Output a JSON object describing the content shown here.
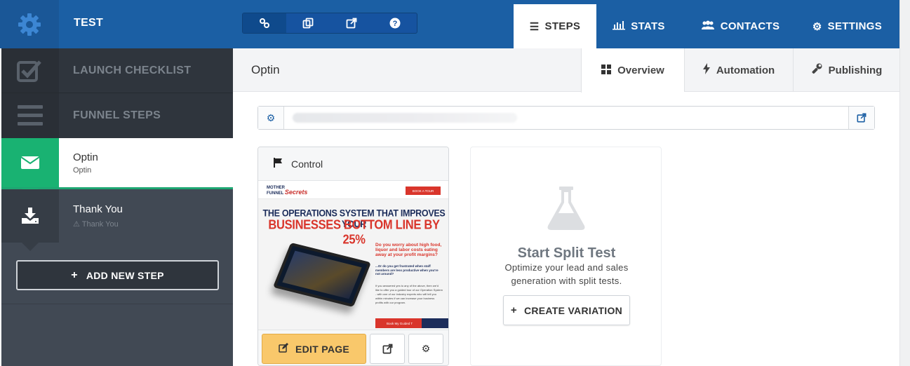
{
  "app": {
    "title": "TEST"
  },
  "toolbar_icons": [
    "link-icon",
    "copy-icon",
    "external-link-icon",
    "help-icon"
  ],
  "top_nav": [
    {
      "label": "STEPS",
      "icon": "menu-icon",
      "active": true
    },
    {
      "label": "STATS",
      "icon": "bar-chart-icon",
      "active": false
    },
    {
      "label": "CONTACTS",
      "icon": "users-icon",
      "active": false
    },
    {
      "label": "SETTINGS",
      "icon": "gear-icon",
      "active": false
    }
  ],
  "sidebar": {
    "launch_checklist": "LAUNCH CHECKLIST",
    "funnel_steps": "FUNNEL STEPS",
    "steps": [
      {
        "name": "Optin",
        "subtitle": "Optin",
        "icon": "envelope-icon",
        "active": true
      },
      {
        "name": "Thank You",
        "subtitle": "Thank You",
        "icon": "download-icon",
        "active": false
      }
    ],
    "add_step_label": "ADD NEW STEP"
  },
  "main": {
    "page_name": "Optin",
    "subtabs": [
      {
        "label": "Overview",
        "icon": "grid-icon",
        "active": true
      },
      {
        "label": "Automation",
        "icon": "bolt-icon",
        "active": false
      },
      {
        "label": "Publishing",
        "icon": "wrench-icon",
        "active": false
      }
    ]
  },
  "control_card": {
    "title": "Control",
    "edit_label": "EDIT PAGE",
    "preview": {
      "logo_top": "MOTHER",
      "logo_mid": "FUNNEL",
      "logo_script": "Secrets",
      "book_button": "BOOK A TOUR",
      "headline_1": "THE OPERATIONS SYSTEM THAT IMPROVES YOUR",
      "headline_2": "BUSINESSES BOTTOM LINE BY 25%",
      "question": "Do you worry about high food, liquor and labor costs eating away at your profit margins?",
      "question_2": "...Or do you get frustrated when staff members are less productive when you're not around?",
      "paragraph": "If you answered yes to any of the above, then we'd like to offer you a guided tour of our Operation System - with one of our industry experts who will tell you within minutes if we can increase your business profits with our program.",
      "cta": "Book My Guided T"
    }
  },
  "split_test": {
    "title": "Start Split Test",
    "description": "Optimize your lead and sales generation with split tests.",
    "button_label": "CREATE VARIATION"
  },
  "colors": {
    "topbar": "#1b5fa4",
    "sidebar": "#414954",
    "active_step": "#19b272",
    "edit_button": "#f9c86b"
  }
}
